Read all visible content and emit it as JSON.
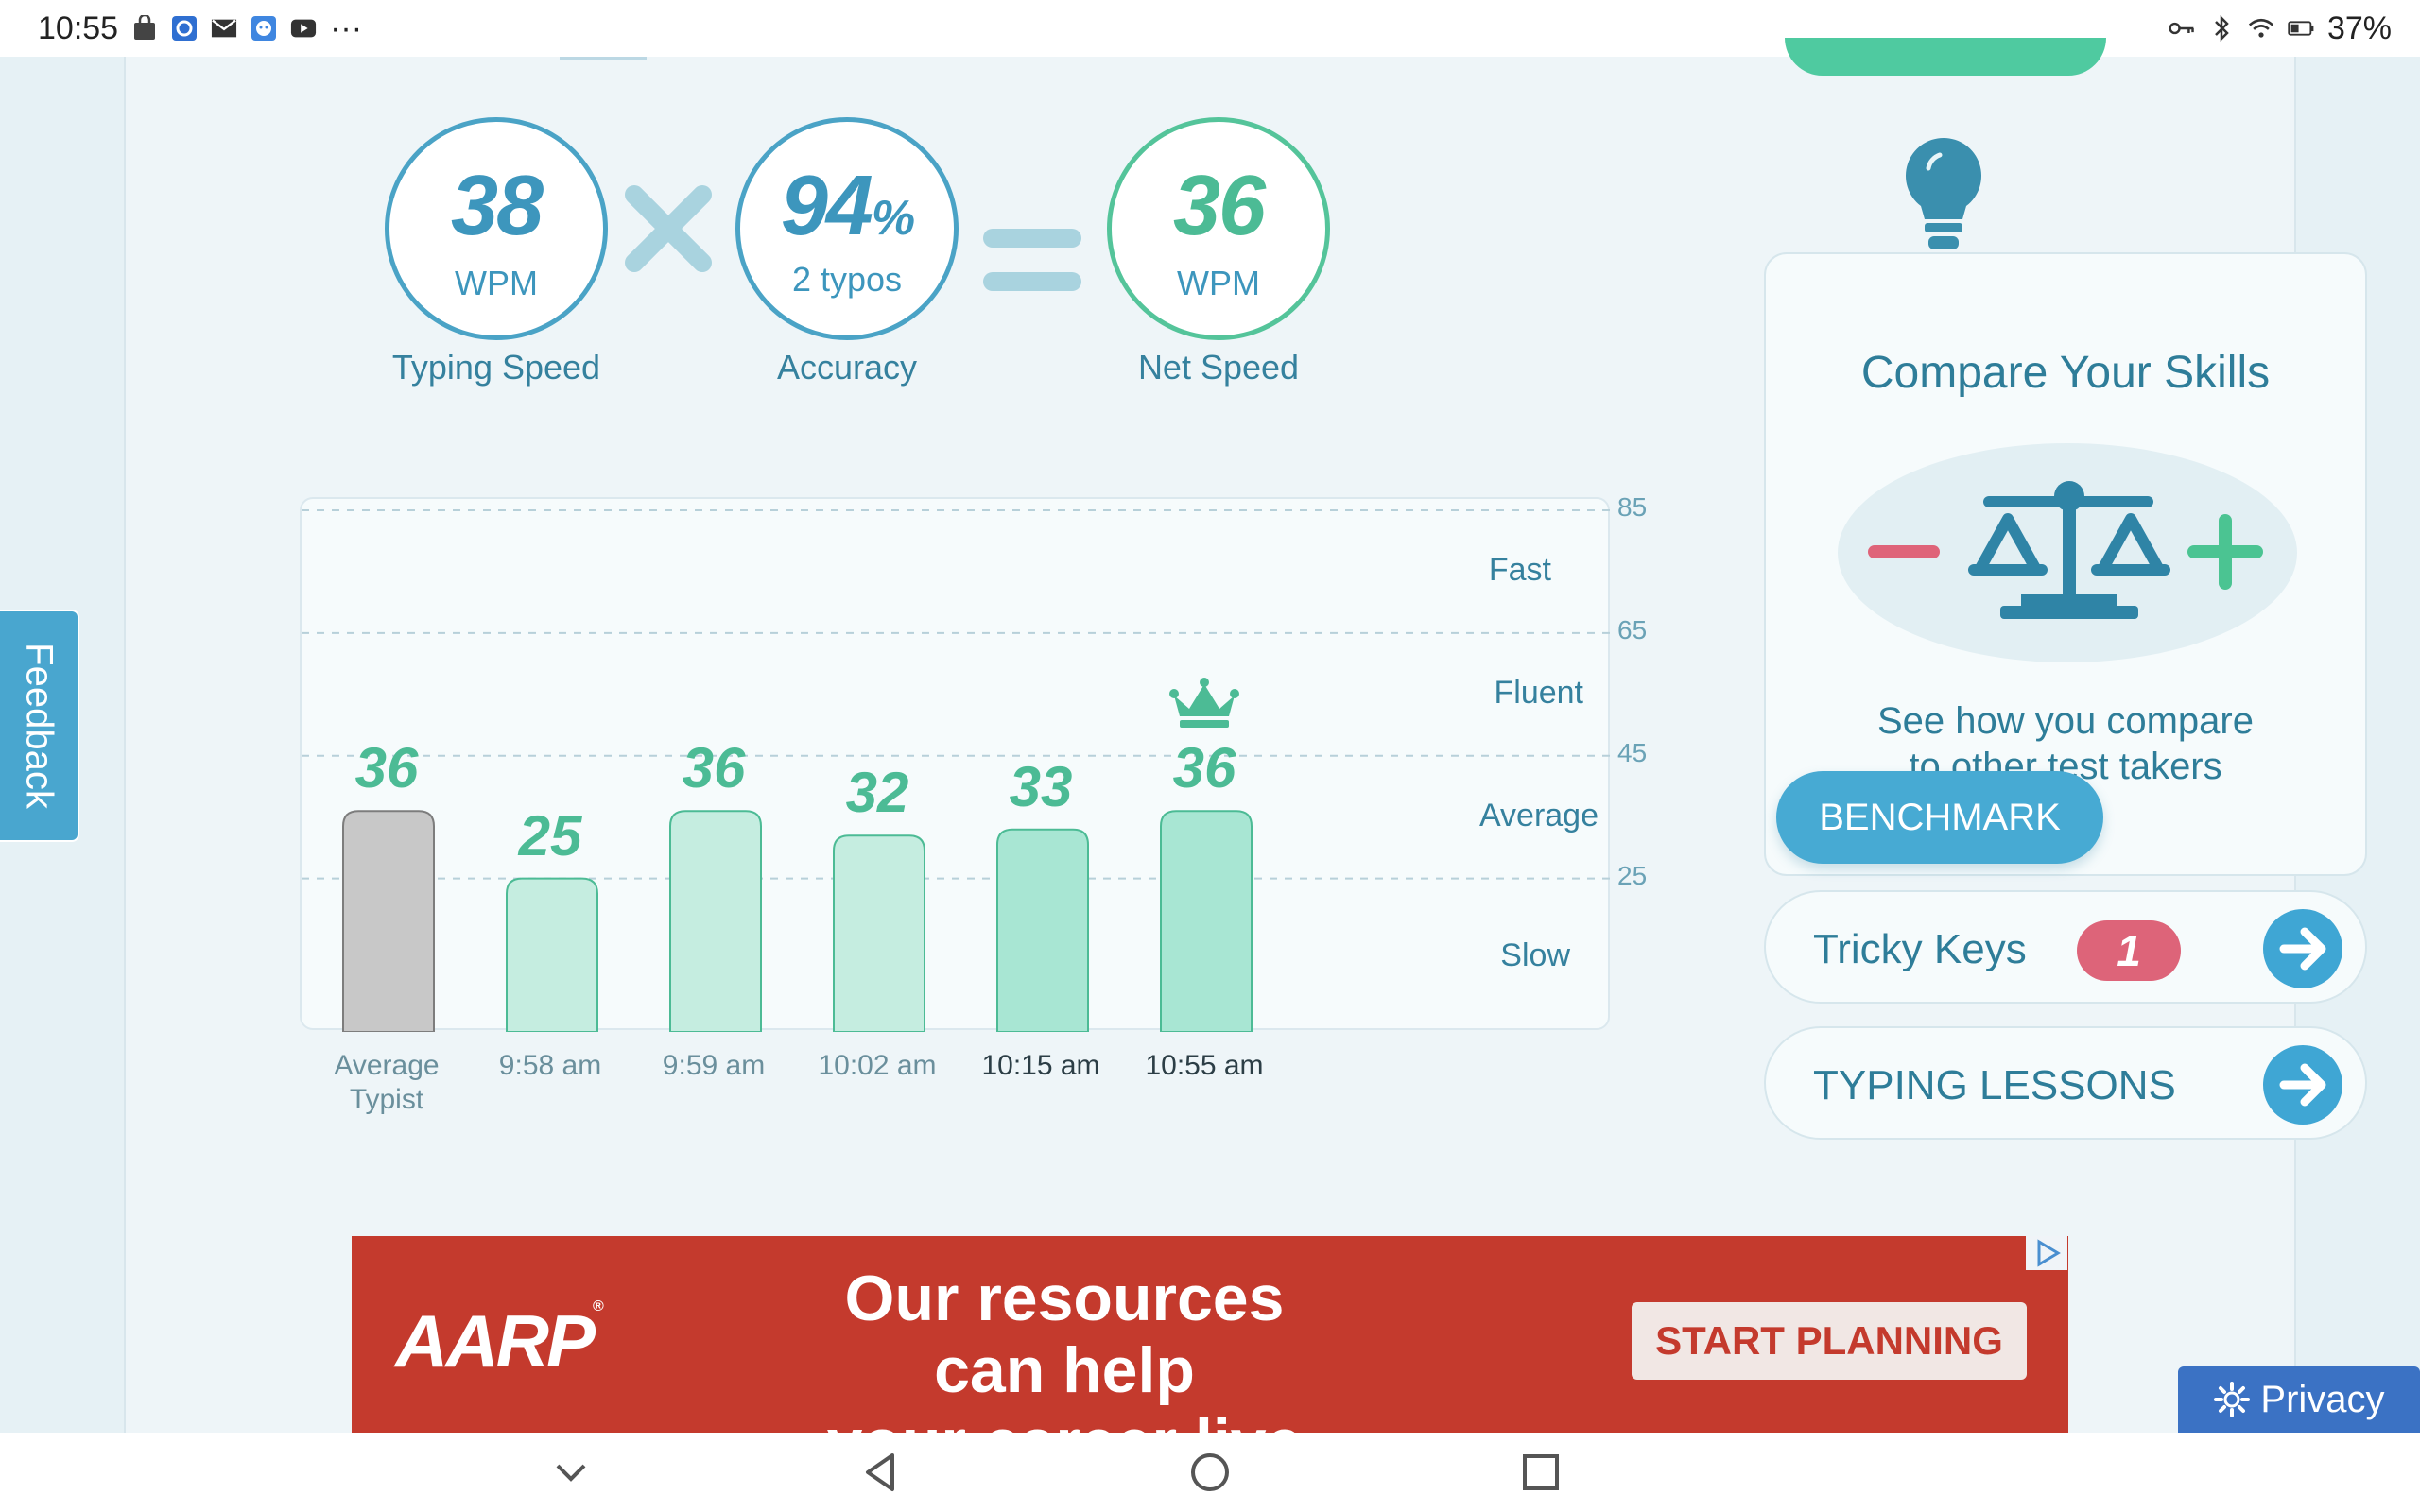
{
  "status_bar": {
    "time": "10:55",
    "more": "···",
    "battery": "37%",
    "icons": [
      "store-icon",
      "sync-icon",
      "mail-icon",
      "chat-icon",
      "video-icon",
      "key-icon",
      "bluetooth-icon",
      "wifi-icon",
      "battery-icon"
    ]
  },
  "stats": {
    "typing_speed": {
      "value": "38",
      "unit": "WPM",
      "label": "Typing Speed"
    },
    "accuracy": {
      "value": "94",
      "pct": "%",
      "sub": "2 typos",
      "label": "Accuracy"
    },
    "net_speed": {
      "value": "36",
      "unit": "WPM",
      "label": "Net Speed"
    }
  },
  "chart_data": {
    "type": "bar",
    "categories": [
      "Average Typist",
      "9:58 am",
      "9:59 am",
      "10:02 am",
      "10:15 am",
      "10:55 am"
    ],
    "values": [
      36,
      25,
      36,
      32,
      33,
      36
    ],
    "ylim": [
      0,
      85
    ],
    "y_ticks": [
      "85",
      "65",
      "45",
      "25"
    ],
    "zones": [
      "Fast",
      "Fluent",
      "Average",
      "Slow"
    ],
    "best_marker": "crown-icon",
    "colors": {
      "average": "#c8c8c8",
      "bar": "#c5ede0",
      "bar_recent": "#a8e6d3",
      "value_text": "#4cbb95"
    }
  },
  "right_panel": {
    "compare_title": "Compare Your Skills",
    "compare_desc_line1": "See how you compare",
    "compare_desc_line2": "to other test takers",
    "benchmark_button": "BENCHMARK",
    "tricky_keys_label": "Tricky Keys",
    "tricky_keys_count": "1",
    "typing_lessons_label": "TYPING LESSONS"
  },
  "feedback": "Feedback",
  "ad": {
    "logo": "AARP",
    "reg": "®",
    "line1": "Our resources can help",
    "line2": "your career live longer.",
    "button": "START PLANNING"
  },
  "privacy": "Privacy",
  "colors": {
    "accent": "#47aad3",
    "green": "#4cbb95",
    "badge": "#dd6479",
    "ad_bg": "#c43a2d"
  }
}
